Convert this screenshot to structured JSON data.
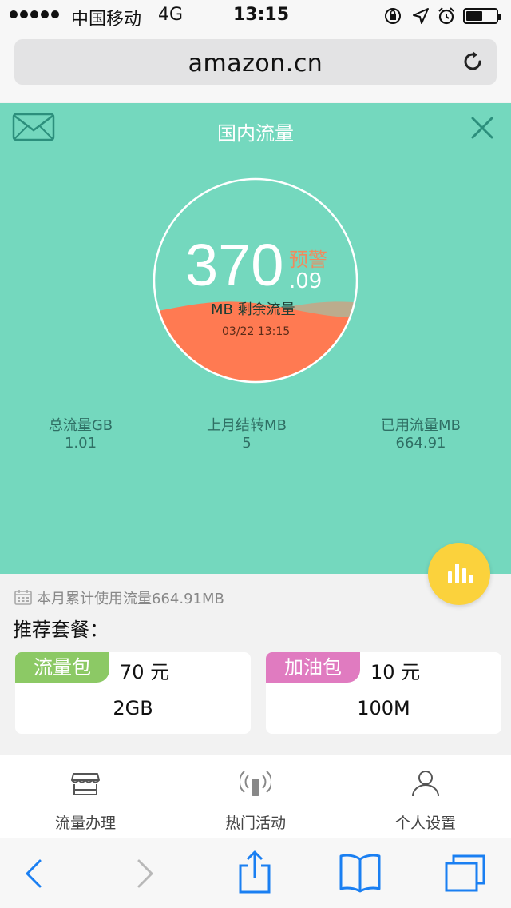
{
  "status_bar": {
    "carrier": "中国移动",
    "network": "4G",
    "time": "13:15",
    "battery_level": 0.55,
    "signal_dots": 5
  },
  "browser": {
    "url": "amazon.cn"
  },
  "header": {
    "title": "国内流量"
  },
  "gauge": {
    "remaining_integer": "370",
    "remaining_decimal": ".09",
    "warning": "预警",
    "label": "MB 剩余流量",
    "timestamp": "03/22 13:15",
    "fill_fraction": 0.36,
    "wave_color": "#ff7a52",
    "ring_color": "#ffffff"
  },
  "stats": [
    {
      "label": "总流量GB",
      "value": "1.01"
    },
    {
      "label": "上月结转MB",
      "value": "5"
    },
    {
      "label": "已用流量MB",
      "value": "664.91"
    }
  ],
  "monthly_usage": "本月累计使用流量664.91MB",
  "recommend_title": "推荐套餐：",
  "plans": [
    {
      "tag": "流量包",
      "price": "70 元",
      "size": "2GB",
      "tag_color": "#8cc965"
    },
    {
      "tag": "加油包",
      "price": "10 元",
      "size": "100M",
      "tag_color": "#e07bc0"
    }
  ],
  "bottom_nav": [
    {
      "label": "流量办理",
      "icon": "shop-icon"
    },
    {
      "label": "热门活动",
      "icon": "phone-signal-icon"
    },
    {
      "label": "个人设置",
      "icon": "user-icon"
    }
  ],
  "colors": {
    "panel_bg": "#74d8be",
    "fab": "#fbd23c",
    "accent_blue": "#1a7ff2"
  }
}
